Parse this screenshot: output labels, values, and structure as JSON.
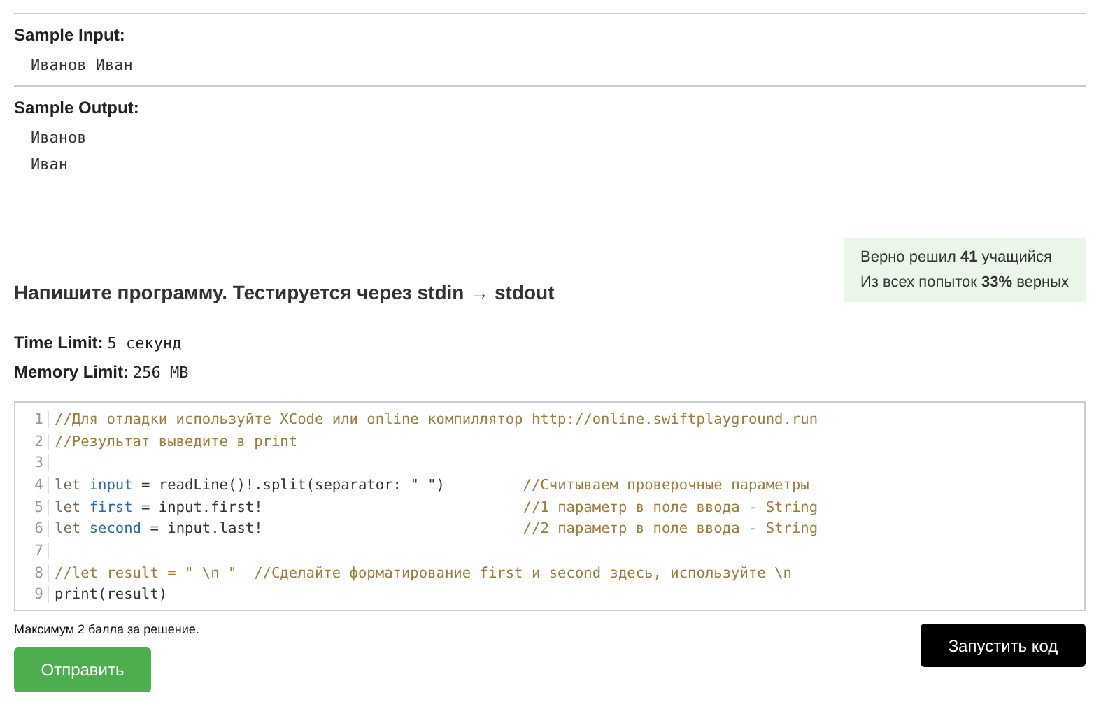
{
  "samples": [
    {
      "label": "Sample Input:",
      "lines": [
        "Иванов Иван"
      ]
    },
    {
      "label": "Sample Output:",
      "lines": [
        "Иванов",
        "Иван"
      ]
    }
  ],
  "stats": [
    "Верно решил **41** учащийся",
    "Из всех попыток **33%** верных"
  ],
  "task_heading": "Напишите программу. Тестируется через stdin → stdout",
  "limits": [
    {
      "label": "Time Limit:",
      "value": "5 секунд"
    },
    {
      "label": "Memory Limit:",
      "value": "256 MB"
    }
  ],
  "code_lines": [
    {
      "number": "1",
      "tokens": [
        {
          "kind": "comment",
          "text": "//Для отладки используйте XCode или online компиллятор http://online.swiftplayground.run"
        }
      ]
    },
    {
      "number": "2",
      "tokens": [
        {
          "kind": "comment",
          "text": "//Результат выведите в print"
        }
      ]
    },
    {
      "number": "3"
    },
    {
      "number": "4",
      "tokens": [
        {
          "kind": "keyword",
          "text": "let "
        },
        {
          "kind": "variable",
          "text": "input"
        },
        {
          "kind": "plain",
          "text": " = readLine()!.split(separator: \" \")         "
        },
        {
          "kind": "comment",
          "text": "//Считываем проверочные параметры"
        }
      ]
    },
    {
      "number": "5",
      "tokens": [
        {
          "kind": "keyword",
          "text": "let "
        },
        {
          "kind": "variable",
          "text": "first"
        },
        {
          "kind": "plain",
          "text": " = input.first!                              "
        },
        {
          "kind": "comment",
          "text": "//1 параметр в поле ввода - String"
        }
      ]
    },
    {
      "number": "6",
      "tokens": [
        {
          "kind": "keyword",
          "text": "let "
        },
        {
          "kind": "variable",
          "text": "second"
        },
        {
          "kind": "plain",
          "text": " = input.last!                              "
        },
        {
          "kind": "comment",
          "text": "//2 параметр в поле ввода - String"
        }
      ]
    },
    {
      "number": "7"
    },
    {
      "number": "8",
      "tokens": [
        {
          "kind": "comment",
          "text": "//let result = \" \\n \"  //Сделайте форматирование first и second здесь, используйте \\n"
        }
      ]
    },
    {
      "number": "9",
      "tokens": [
        {
          "kind": "plain",
          "text": "print(result)"
        }
      ]
    }
  ],
  "score_note": "Максимум 2 балла за решение.",
  "run_button": "Запустить код",
  "submit_button": "Отправить"
}
